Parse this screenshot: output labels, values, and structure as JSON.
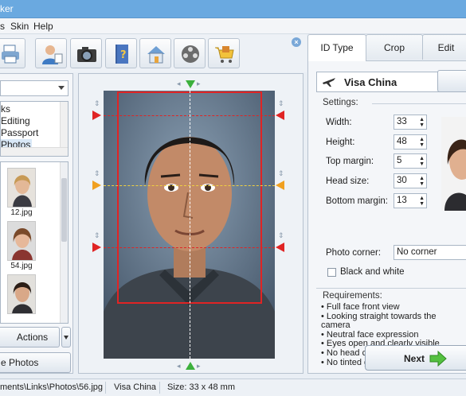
{
  "window": {
    "title": "ker"
  },
  "menu": [
    "s",
    "Skin",
    "Help"
  ],
  "toolbar": {
    "buttons": [
      "printer-icon",
      "user-icon",
      "camera-icon",
      "book-icon",
      "home-icon",
      "film-icon",
      "cart-icon"
    ]
  },
  "left_panel": {
    "tree_items": [
      "ks",
      "Editing",
      "Passport",
      "Photos"
    ],
    "thumbnails": [
      {
        "caption": "12.jpg"
      },
      {
        "caption": "54.jpg"
      },
      {
        "caption": ""
      }
    ],
    "actions_label": "Actions",
    "bottom_button_label": "e Photos"
  },
  "tabs": [
    "ID Type",
    "Crop",
    "Edit"
  ],
  "id_type": {
    "selected": "Visa China"
  },
  "settings": {
    "heading": "Settings:",
    "fields": [
      {
        "label": "Width:",
        "value": "33"
      },
      {
        "label": "Height:",
        "value": "48"
      },
      {
        "label": "Top margin:",
        "value": "5"
      },
      {
        "label": "Head size:",
        "value": "30"
      },
      {
        "label": "Bottom margin:",
        "value": "13"
      }
    ],
    "photo_corner_label": "Photo corner:",
    "photo_corner_value": "No corner",
    "black_white_label": "Black and white",
    "black_white_checked": false
  },
  "requirements": {
    "heading": "Requirements:",
    "items": [
      "Full face front view",
      "Looking straight towards the camera",
      "Neutral face expression",
      "Eyes open and clearly visible",
      "No head covering",
      "No tinted glasses or sunglasses"
    ]
  },
  "next_label": "Next",
  "status": {
    "path": "ments\\Links\\Photos\\56.jpg",
    "id_type": "Visa China",
    "size": "Size: 33 x 48 mm"
  },
  "colors": {
    "accent": "#6aa9e0",
    "crop_frame": "#e02424",
    "eye_line": "#f0d040"
  }
}
